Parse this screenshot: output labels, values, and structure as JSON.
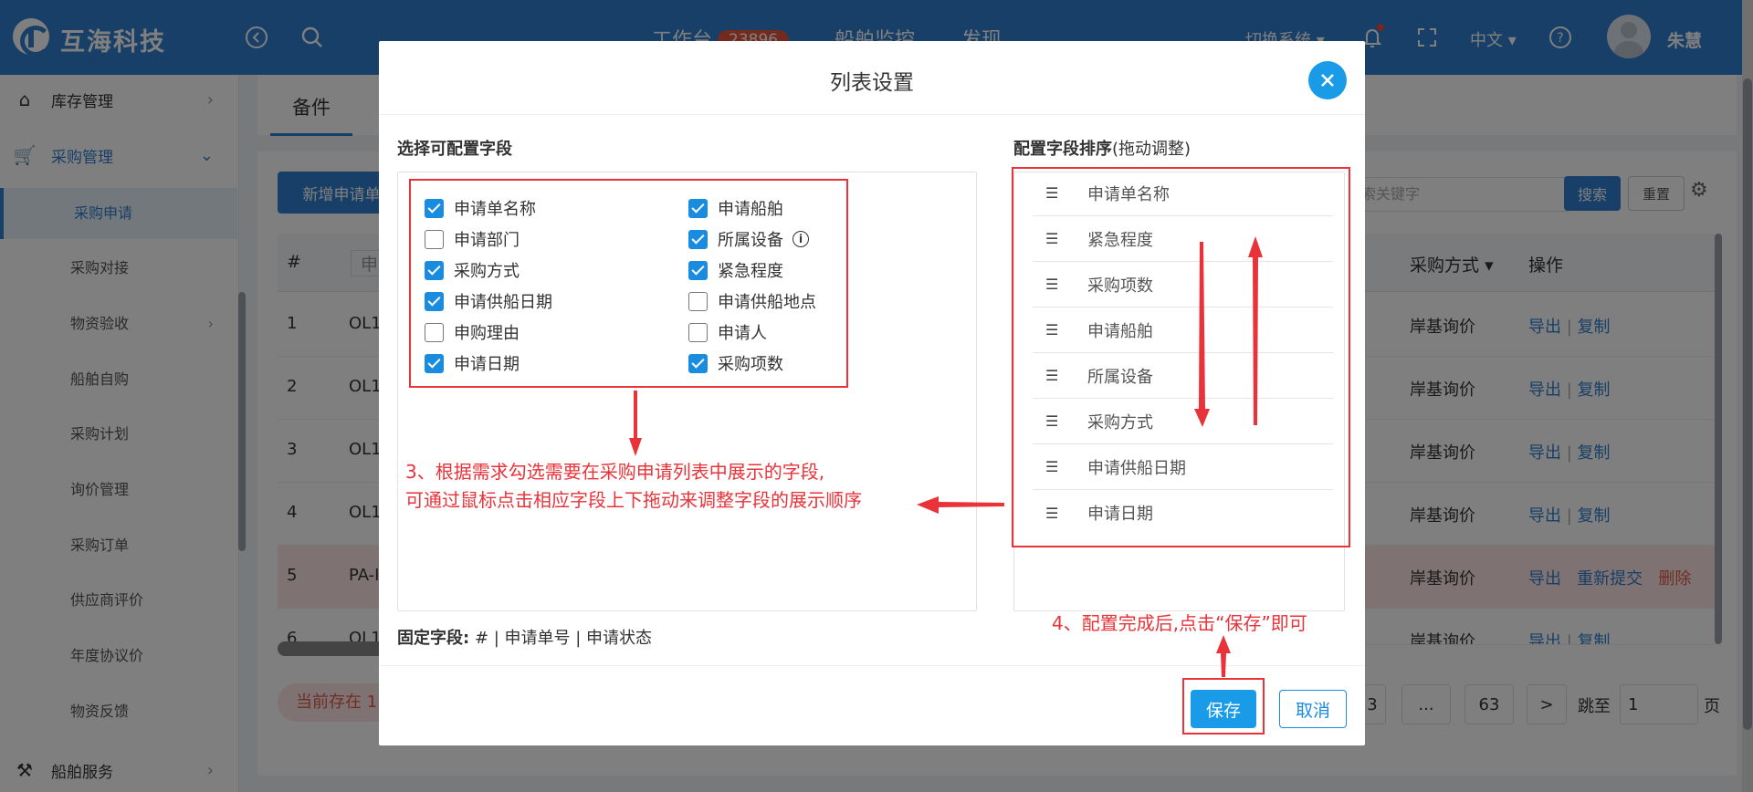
{
  "topbar": {
    "brand": "互海科技",
    "nav": [
      {
        "label": "工作台",
        "badge": "23896"
      },
      {
        "label": "船舶监控"
      },
      {
        "label": "发现"
      }
    ],
    "switch_system": "切换系统",
    "language": "中文",
    "username": "朱慧"
  },
  "sidebar": {
    "items": [
      {
        "label": "库存管理"
      },
      {
        "label": "采购管理"
      }
    ],
    "sub_items": [
      "采购申请",
      "采购对接",
      "物资验收",
      "船舶自购",
      "采购计划",
      "询价管理",
      "采购订单",
      "供应商评价",
      "年度协议价",
      "物资反馈"
    ],
    "bottom_item": "船舶服务"
  },
  "main": {
    "tab": "备件",
    "new_button": "新增申请单",
    "search_placeholder": "索关键字",
    "search_button": "搜索",
    "reset_button": "重置",
    "table": {
      "headers": {
        "index": "#",
        "name_partial": "申",
        "purchase_method": "采购方式",
        "ops": "操作"
      },
      "rows": [
        {
          "index": "1",
          "code": "OL1",
          "method": "岸基询价",
          "ops": [
            "导出",
            "复制"
          ]
        },
        {
          "index": "2",
          "code": "OL1",
          "method": "岸基询价",
          "ops": [
            "导出",
            "复制"
          ]
        },
        {
          "index": "3",
          "code": "OL1",
          "method": "岸基询价",
          "ops": [
            "导出",
            "复制"
          ]
        },
        {
          "index": "4",
          "code": "OL1",
          "method": "岸基询价",
          "ops": [
            "导出",
            "复制"
          ]
        },
        {
          "index": "5",
          "code": "PA-I",
          "method": "岸基询价",
          "ops": [
            "导出",
            "重新提交",
            "删除"
          ]
        },
        {
          "index": "6",
          "code": "OL1",
          "method": "岸基询价",
          "ops": [
            "导出",
            "复制"
          ]
        }
      ]
    },
    "total_text": "当前存在 1",
    "pagination": {
      "pages": [
        "3",
        "...",
        "63"
      ],
      "next": ">",
      "jump_label": "跳至",
      "jump_value": "1",
      "page_unit": "页"
    }
  },
  "modal": {
    "title": "列表设置",
    "left_title": "选择可配置字段",
    "right_title": "配置字段排序",
    "right_subtitle": "(拖动调整)",
    "fields": [
      {
        "label": "申请单名称",
        "checked": true
      },
      {
        "label": "申请船舶",
        "checked": true
      },
      {
        "label": "申请部门",
        "checked": false
      },
      {
        "label": "所属设备",
        "checked": true
      },
      {
        "label": "采购方式",
        "checked": true
      },
      {
        "label": "紧急程度",
        "checked": true
      },
      {
        "label": "申请供船日期",
        "checked": true
      },
      {
        "label": "申请供船地点",
        "checked": false
      },
      {
        "label": "申购理由",
        "checked": false
      },
      {
        "label": "申请人",
        "checked": false
      },
      {
        "label": "申请日期",
        "checked": true
      },
      {
        "label": "采购项数",
        "checked": true
      }
    ],
    "sorted_fields": [
      "申请单名称",
      "紧急程度",
      "采购项数",
      "申请船舶",
      "所属设备",
      "采购方式",
      "申请供船日期",
      "申请日期"
    ],
    "fixed_label": "固定字段:",
    "fixed_value": "# | 申请单号 | 申请状态",
    "save_button": "保存",
    "cancel_button": "取消"
  },
  "annotations": {
    "step3_line1": "3、根据需求勾选需要在采购申请列表中展示的字段,",
    "step3_line2": "可通过鼠标点击相应字段上下拖动来调整字段的展示顺序",
    "step4": "4、配置完成后,点击“保存”即可"
  },
  "colors": {
    "topbar": "#2f7fcf",
    "accent": "#1a9be8",
    "annotation": "#e8333a"
  }
}
